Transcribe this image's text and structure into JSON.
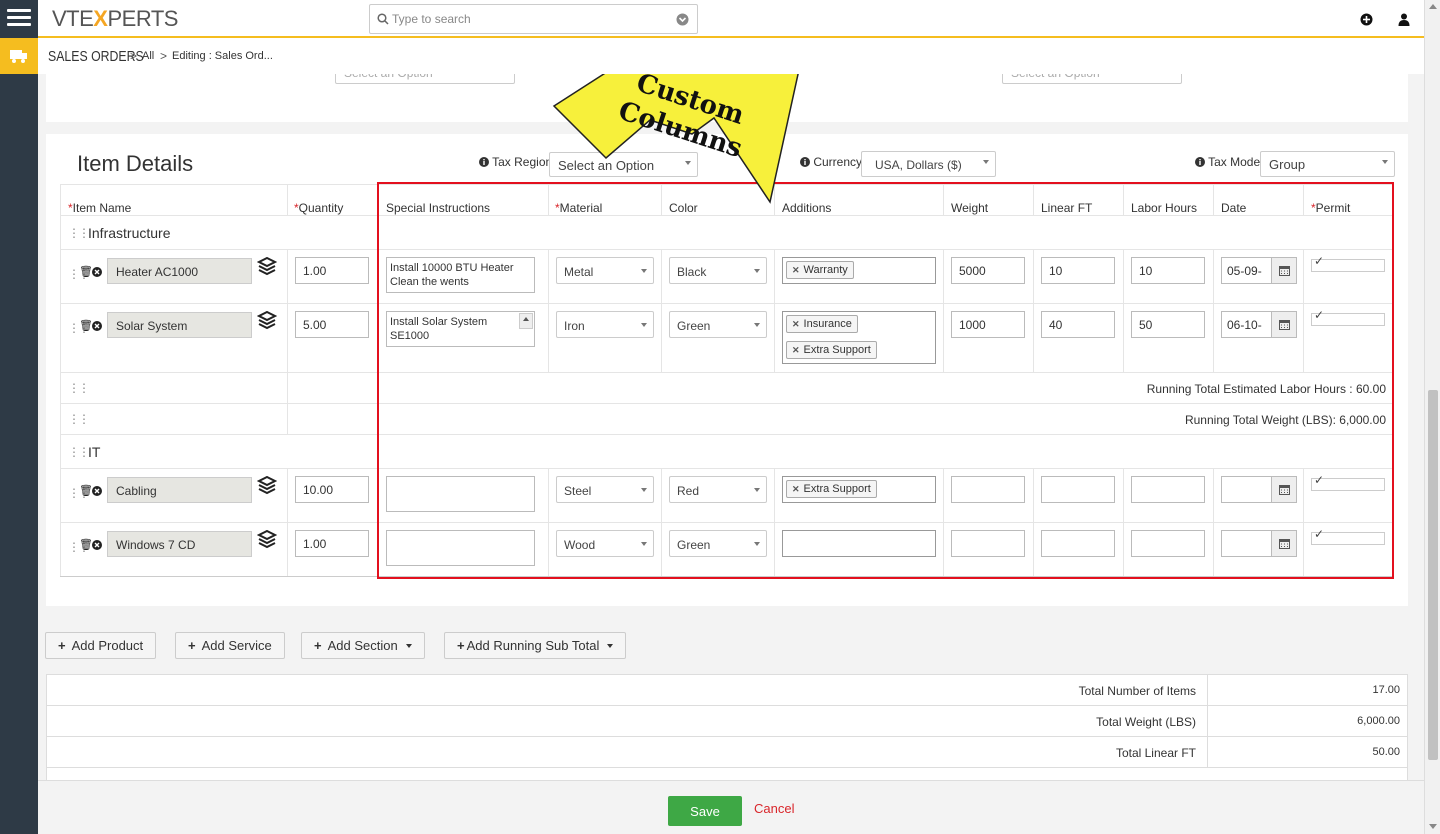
{
  "app": {
    "logo_pre": "VTE",
    "logo_x": "X",
    "logo_post": "PERTS"
  },
  "search": {
    "placeholder": "Type to search"
  },
  "breadcrumb": {
    "module": "SALES ORDERS",
    "sep": ">",
    "all": "All",
    "editing": "Editing : Sales Ord..."
  },
  "top_partial": {
    "select1": "Select an Option",
    "select2": "Select an Option"
  },
  "callout": {
    "line1": "Custom",
    "line2": "Columns",
    "color": "#f7f03b"
  },
  "item_details": {
    "title": "Item Details",
    "tax_region_label": "Tax Region",
    "tax_region_value": "Select an Option",
    "currency_label": "Currency",
    "currency_value": "USA, Dollars ($)",
    "tax_mode_label": "Tax Mode",
    "tax_mode_value": "Group"
  },
  "columns": {
    "item_name": "Item Name",
    "quantity": "Quantity",
    "special": "Special Instructions",
    "material": "Material",
    "color": "Color",
    "additions": "Additions",
    "weight": "Weight",
    "linear": "Linear FT",
    "labor": "Labor Hours",
    "date": "Date",
    "permit": "Permit",
    "required_mark": "*"
  },
  "sections": [
    {
      "name": "Infrastructure",
      "rows": [
        {
          "item": "Heater AC1000",
          "qty": "1.00",
          "special": "Install 10000 BTU Heater Clean the wents",
          "material": "Metal",
          "color": "Black",
          "additions": [
            "Warranty"
          ],
          "weight": "5000",
          "linear": "10",
          "labor": "10",
          "date": "05-09-"
        },
        {
          "item": "Solar System",
          "qty": "5.00",
          "special": "Install Solar System SE1000",
          "material": "Iron",
          "color": "Green",
          "additions": [
            "Insurance",
            "Extra Support"
          ],
          "weight": "1000",
          "linear": "40",
          "labor": "50",
          "date": "06-10-"
        }
      ]
    },
    {
      "name": "IT",
      "rows": [
        {
          "item": "Cabling",
          "qty": "10.00",
          "special": "",
          "material": "Steel",
          "color": "Red",
          "additions": [
            "Extra Support"
          ],
          "weight": "",
          "linear": "",
          "labor": "",
          "date": ""
        },
        {
          "item": "Windows 7 CD",
          "qty": "1.00",
          "special": "",
          "material": "Wood",
          "color": "Green",
          "additions": [],
          "weight": "",
          "linear": "",
          "labor": "",
          "date": ""
        }
      ]
    }
  ],
  "running_totals": {
    "labor": "Running Total Estimated Labor Hours : 60.00",
    "weight": "Running Total Weight (LBS): 6,000.00"
  },
  "buttons": {
    "add_product": "Add Product",
    "add_service": "Add Service",
    "add_section": "Add Section",
    "add_running": "Add Running Sub Total"
  },
  "totals": [
    {
      "label": "Total Number of Items",
      "value": "17.00"
    },
    {
      "label": "Total Weight (LBS)",
      "value": "6,000.00"
    },
    {
      "label": "Total Linear FT",
      "value": "50.00"
    }
  ],
  "footer": {
    "save": "Save",
    "cancel": "Cancel"
  },
  "colors": {
    "accent": "#f5bd1f",
    "highlight": "#e3101e",
    "save": "#3ea845",
    "sidebar": "#2e3a46"
  }
}
